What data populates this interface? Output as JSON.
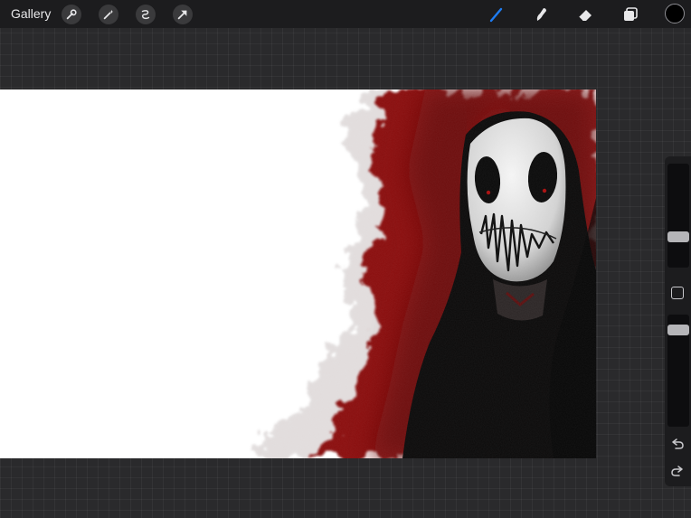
{
  "topbar": {
    "gallery_label": "Gallery",
    "left_tools": [
      "wrench-icon",
      "magic-wand-icon",
      "selection-icon",
      "transform-arrow-icon"
    ],
    "right_tools": [
      "brush-icon",
      "smudge-icon",
      "eraser-icon",
      "layers-icon"
    ],
    "active_tool": "brush-icon",
    "accent_color": "#1e7cf2",
    "current_color": "#000000"
  },
  "sidebar": {
    "brush_size_level": 0.27,
    "opacity_level": 0.9,
    "icons": [
      "modify-square-icon",
      "undo-icon",
      "redo-icon"
    ]
  },
  "canvas": {
    "artwork_colors": {
      "background": "#ffffff",
      "blood_red": "#7a0a0a",
      "hood": "#0b0a0a",
      "mask": "#e6e6e6"
    }
  }
}
